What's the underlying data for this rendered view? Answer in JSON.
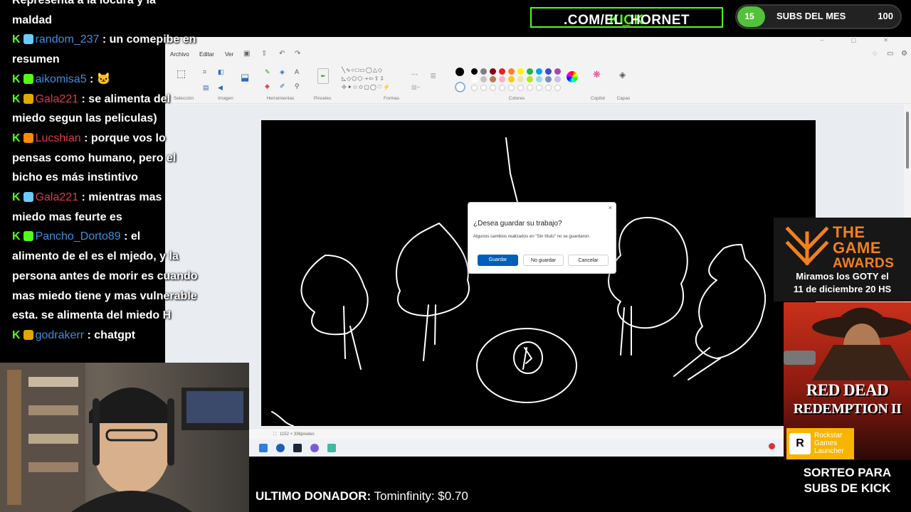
{
  "paint": {
    "menu": [
      "Archivo",
      "Editar",
      "Ver"
    ],
    "groups": {
      "seleccion": "Selección",
      "imagen": "Imagen",
      "herramientas": "Herramientas",
      "pinceles": "Pinceles",
      "formas": "Formas",
      "colores": "Colores",
      "copilot": "Copilot",
      "capas": "Capas"
    },
    "palette_row1": [
      "#000000",
      "#7f7f7f",
      "#880015",
      "#ed1c24",
      "#ff7f27",
      "#fff200",
      "#22b14c",
      "#00a2e8",
      "#3f48cc",
      "#a349a4"
    ],
    "palette_row2": [
      "#ffffff",
      "#c3c3c3",
      "#b97a57",
      "#ffaec9",
      "#ffc90e",
      "#efe4b0",
      "#b5e61d",
      "#99d9ea",
      "#7092be",
      "#c8bfe7"
    ],
    "status_size": "1152 × 336píxeles",
    "dialog": {
      "title": "¿Desea guardar su trabajo?",
      "message": "Algunos cambios realizados en \"Sin título\" no se guardaron.",
      "save": "Guardar",
      "dont_save": "No guardar",
      "cancel": "Cancelar",
      "close": "×"
    }
  },
  "chat": {
    "messages": [
      {
        "user": "",
        "color": "#ffffff",
        "text": "Representa a la locura y la"
      },
      {
        "user": "",
        "color": "#ffffff",
        "text": "maldad"
      },
      {
        "user": "random_237",
        "color": "#3b8fe0",
        "text": ": un comepibe en"
      },
      {
        "user": "",
        "color": "#ffffff",
        "text": "resumen"
      },
      {
        "user": "aikomisa5",
        "color": "#3b8fe0",
        "text": ": 🐱"
      },
      {
        "user": "Gala221",
        "color": "#e0394f",
        "text": ": se alimenta del"
      },
      {
        "user": "",
        "color": "#ffffff",
        "text": "miedo segun las peliculas)"
      },
      {
        "user": "Lucshian",
        "color": "#e0394f",
        "text": ": porque vos lo"
      },
      {
        "user": "",
        "color": "#ffffff",
        "text": "pensas como humano, pero el"
      },
      {
        "user": "",
        "color": "#ffffff",
        "text": "bicho es más instintivo"
      },
      {
        "user": "Gala221",
        "color": "#e0394f",
        "text": ": mientras mas"
      },
      {
        "user": "",
        "color": "#ffffff",
        "text": "miedo mas feurte es"
      },
      {
        "user": "Pancho_Dorto89",
        "color": "#3b8fe0",
        "text": ": el"
      },
      {
        "user": "",
        "color": "#ffffff",
        "text": "alimento de el es el mjedo, y la"
      },
      {
        "user": "",
        "color": "#ffffff",
        "text": "persona antes de morir es cuando"
      },
      {
        "user": "",
        "color": "#ffffff",
        "text": "mas miedo tiene y mas vulnerable"
      },
      {
        "user": "",
        "color": "#ffffff",
        "text": "esta. se alimenta del miedo H"
      },
      {
        "user": "godrakerr",
        "color": "#3b8fe0",
        "text": ": chatgpt"
      }
    ]
  },
  "kick_banner": {
    "prefix": "KICK",
    "suffix": ".COM/EL_HORNET"
  },
  "subs": {
    "current": "15",
    "label": "SUBS DEL MES",
    "goal": "100",
    "progress": 0.15
  },
  "goty": {
    "line_the": "THE",
    "line_game": "GAME",
    "line_awards": "AWARDS",
    "line1": "Miramos los GOTY el",
    "line2": "11 de diciembre 20 HS"
  },
  "rdr": {
    "title1": "RED DEAD",
    "title2": "REDEMPTION II"
  },
  "rockstar": {
    "logo": "R",
    "line1": "Rockstar",
    "line2": "Games",
    "line3": "Launcher"
  },
  "sorteo": {
    "line1": "SORTEO PARA",
    "line2": "SUBS DE KICK"
  },
  "donor": {
    "label": "ULTIMO DONADOR:",
    "value": "Tominfinity: $0.70"
  },
  "colors": {
    "kick_green": "#53fc18",
    "goty_orange": "#f2811d",
    "rockstar_yellow": "#f7b500"
  }
}
